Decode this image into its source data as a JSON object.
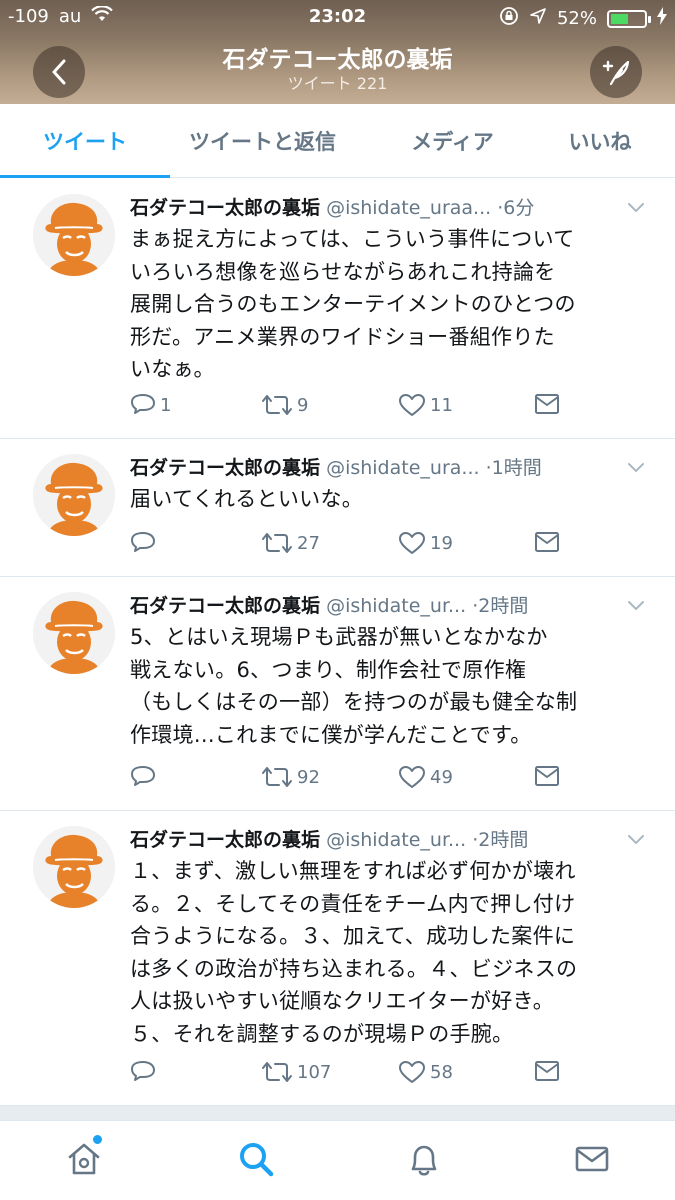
{
  "status_bar": {
    "signal": "-109",
    "carrier": "au",
    "time": "23:02",
    "battery_percent": "52%",
    "battery_level": 0.52
  },
  "profile_header": {
    "title": "石ダテコー太郎の裏垢",
    "subtitle": "ツイート 221"
  },
  "tabs": [
    {
      "label": "ツイート",
      "active": true
    },
    {
      "label": "ツイートと返信",
      "active": false
    },
    {
      "label": "メディア",
      "active": false
    },
    {
      "label": "いいね",
      "active": false
    }
  ],
  "tweets": [
    {
      "name": "石ダテコー太郎の裏垢",
      "handle": "@ishidate_uraa...",
      "time": "·6分",
      "text_lines": [
        "まぁ捉え方によっては、こういう事件について",
        "いろいろ想像を巡らせながらあれこれ持論を",
        "展開し合うのもエンターテイメントのひとつの",
        "形だ。アニメ業界のワイドショー番組作りた",
        "いなぁ。"
      ],
      "replies": "1",
      "retweets": "9",
      "likes": "11"
    },
    {
      "name": "石ダテコー太郎の裏垢",
      "handle": "@ishidate_ura...",
      "time": "·1時間",
      "text_lines": [
        "届いてくれるといいな。"
      ],
      "replies": "",
      "retweets": "27",
      "likes": "19"
    },
    {
      "name": "石ダテコー太郎の裏垢",
      "handle": "@ishidate_ur...",
      "time": "·2時間",
      "text_lines": [
        "5、とはいえ現場Ｐも武器が無いとなかなか",
        "戦えない。6、つまり、制作会社で原作権",
        "（もしくはその一部）を持つのが最も健全な制",
        "作環境...これまでに僕が学んだことです。"
      ],
      "replies": "",
      "retweets": "92",
      "likes": "49"
    },
    {
      "name": "石ダテコー太郎の裏垢",
      "handle": "@ishidate_ur...",
      "time": "·2時間",
      "text_lines": [
        "１、まず、激しい無理をすれば必ず何かが壊れ",
        "る。２、そしてその責任をチーム内で押し付け",
        "合うようになる。３、加えて、成功した案件に",
        "は多くの政治が持ち込まれる。４、ビジネスの",
        "人は扱いやすい従順なクリエイターが好き。",
        "５、それを調整するのが現場Ｐの手腕。"
      ],
      "replies": "",
      "retweets": "107",
      "likes": "58"
    }
  ],
  "colors": {
    "accent": "#1da1f2",
    "secondary_text": "#657786",
    "avatar_orange": "#e8822a"
  }
}
